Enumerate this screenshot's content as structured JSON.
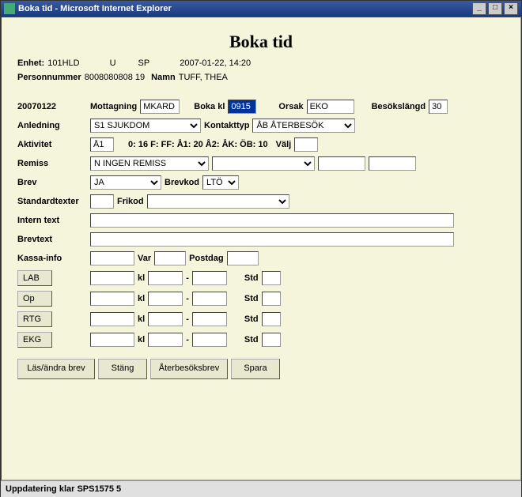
{
  "window": {
    "title": "Boka tid - Microsoft Internet Explorer"
  },
  "page": {
    "title": "Boka tid"
  },
  "header": {
    "enhet_label": "Enhet:",
    "enhet_value": "101HLD",
    "u": "U",
    "sp": "SP",
    "datetime": "2007-01-22, 14:20"
  },
  "patient": {
    "pnr_label": "Personnummer",
    "pnr_value": "8008080808 19",
    "name_label": "Namn",
    "name_value": "TUFF, THEA"
  },
  "booking": {
    "date": "20070122",
    "mottagning_label": "Mottagning",
    "mottagning_value": "MKARD",
    "bokakl_label": "Boka kl",
    "bokakl_value": "0915",
    "orsak_label": "Orsak",
    "orsak_value": "EKO",
    "besokslangd_label": "Besökslängd",
    "besokslangd_value": "30"
  },
  "anledning": {
    "label": "Anledning",
    "value": "S1 SJUKDOM",
    "kontakttyp_label": "Kontakttyp",
    "kontakttyp_value": "ÅB ÅTERBESÖK"
  },
  "aktivitet": {
    "label": "Aktivitet",
    "value": "Å1",
    "codes": "0: 16 F: FF: Å1: 20 Å2: ÅK: ÖB: 10",
    "valj": "Välj"
  },
  "remiss": {
    "label": "Remiss",
    "value": "N INGEN REMISS"
  },
  "brev": {
    "label": "Brev",
    "value": "JA",
    "brevkod_label": "Brevkod",
    "brevkod_value": "LTÖ"
  },
  "standard": {
    "label": "Standardtexter",
    "frikod_label": "Frikod"
  },
  "intern": {
    "label": "Intern text"
  },
  "brevtext": {
    "label": "Brevtext"
  },
  "kassa": {
    "label": "Kassa-info",
    "var_label": "Var",
    "postdag_label": "Postdag"
  },
  "exams": {
    "kl": "kl",
    "dash": "-",
    "std": "Std",
    "rows": [
      {
        "btn": "LAB"
      },
      {
        "btn": "Op"
      },
      {
        "btn": "RTG"
      },
      {
        "btn": "EKG"
      }
    ]
  },
  "buttons": {
    "las": "Läs/ändra brev",
    "stang": "Stäng",
    "ater": "Återbesöksbrev",
    "spara": "Spara"
  },
  "status": "Uppdatering klar SPS1575 5",
  "titlebar_buttons": {
    "min": "_",
    "max": "□",
    "close": "×"
  }
}
